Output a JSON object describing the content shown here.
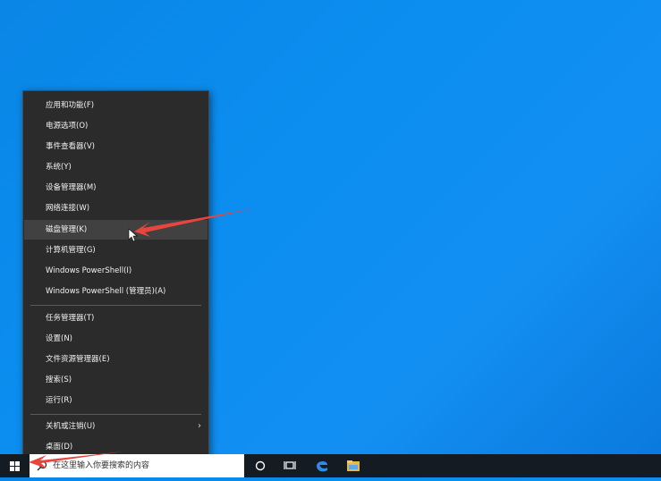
{
  "context_menu": {
    "items": [
      {
        "label": "应用和功能(F)"
      },
      {
        "label": "电源选项(O)"
      },
      {
        "label": "事件查看器(V)"
      },
      {
        "label": "系统(Y)"
      },
      {
        "label": "设备管理器(M)"
      },
      {
        "label": "网络连接(W)"
      },
      {
        "label": "磁盘管理(K)",
        "highlighted": true
      },
      {
        "label": "计算机管理(G)"
      },
      {
        "label": "Windows PowerShell(I)"
      },
      {
        "label": "Windows PowerShell (管理员)(A)"
      },
      {
        "label": "任务管理器(T)"
      },
      {
        "label": "设置(N)"
      },
      {
        "label": "文件资源管理器(E)"
      },
      {
        "label": "搜索(S)"
      },
      {
        "label": "运行(R)"
      },
      {
        "label": "关机或注销(U)",
        "submenu": true
      },
      {
        "label": "桌面(D)"
      }
    ],
    "submenu_glyph": "›"
  },
  "taskbar": {
    "search_placeholder": "在这里输入你要搜索的内容",
    "icons": [
      "start-icon",
      "search-icon",
      "cortana-icon",
      "task-view-icon",
      "edge-icon",
      "file-explorer-icon"
    ]
  },
  "colors": {
    "menu_bg": "#2b2b2b",
    "menu_hover": "#414141",
    "desktop": "#0b8ef0",
    "taskbar": "#151b22",
    "annotation_arrow": "#e8453c"
  }
}
